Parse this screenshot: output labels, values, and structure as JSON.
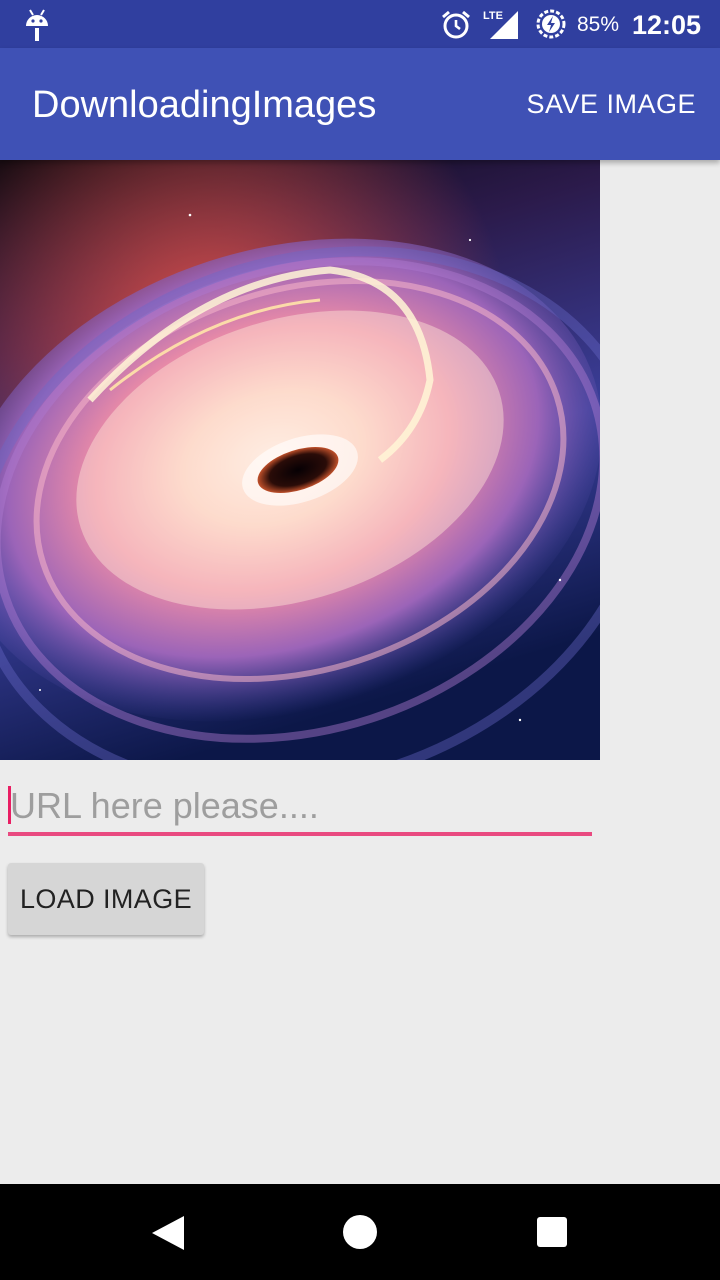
{
  "status_bar": {
    "battery_percent": "85%",
    "time": "12:05",
    "network": "LTE",
    "icons": [
      "android-icon",
      "alarm-icon",
      "lte-signal-icon",
      "battery-saver-icon"
    ],
    "background_color": "#303F9F"
  },
  "app_bar": {
    "title": "DownloadingImages",
    "action_label": "SAVE IMAGE",
    "background_color": "#3F51B5"
  },
  "image": {
    "description_icon": "black-hole-galaxy-image"
  },
  "url_input": {
    "value": "",
    "placeholder": "URL here please....",
    "accent_color": "#E91E63"
  },
  "load_button": {
    "label": "LOAD IMAGE"
  },
  "nav_bar": {
    "icons": [
      "back-icon",
      "home-icon",
      "recents-icon"
    ]
  }
}
